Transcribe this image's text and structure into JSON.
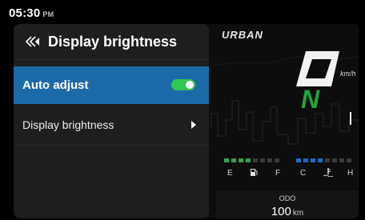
{
  "status": {
    "time": "05:30",
    "ampm": "PM"
  },
  "panel": {
    "title": "Display brightness",
    "back_icon": "double-chevron-left-icon",
    "items": [
      {
        "label": "Auto adjust",
        "control": "toggle",
        "state": "on",
        "selected": true
      },
      {
        "label": "Display brightness",
        "control": "chevron-right-icon"
      }
    ]
  },
  "cluster": {
    "mode": "URBAN",
    "speed": "0",
    "speed_unit": "km/h",
    "gear": "N",
    "fuel_labels": [
      "E",
      "F"
    ],
    "temp_labels": [
      "C",
      "H"
    ],
    "fuel_icon": "fuel-pump-icon",
    "temp_icon": "coolant-temp-icon",
    "odo_label": "ODO",
    "odo_value": "100",
    "odo_unit": "km"
  },
  "colors": {
    "selected_row": "#1d6aa8",
    "toggle_on": "#32c752",
    "gear": "#1fa73e",
    "fuel_segments": "#2ea44f",
    "temp_segments": "#1e6fc7"
  }
}
